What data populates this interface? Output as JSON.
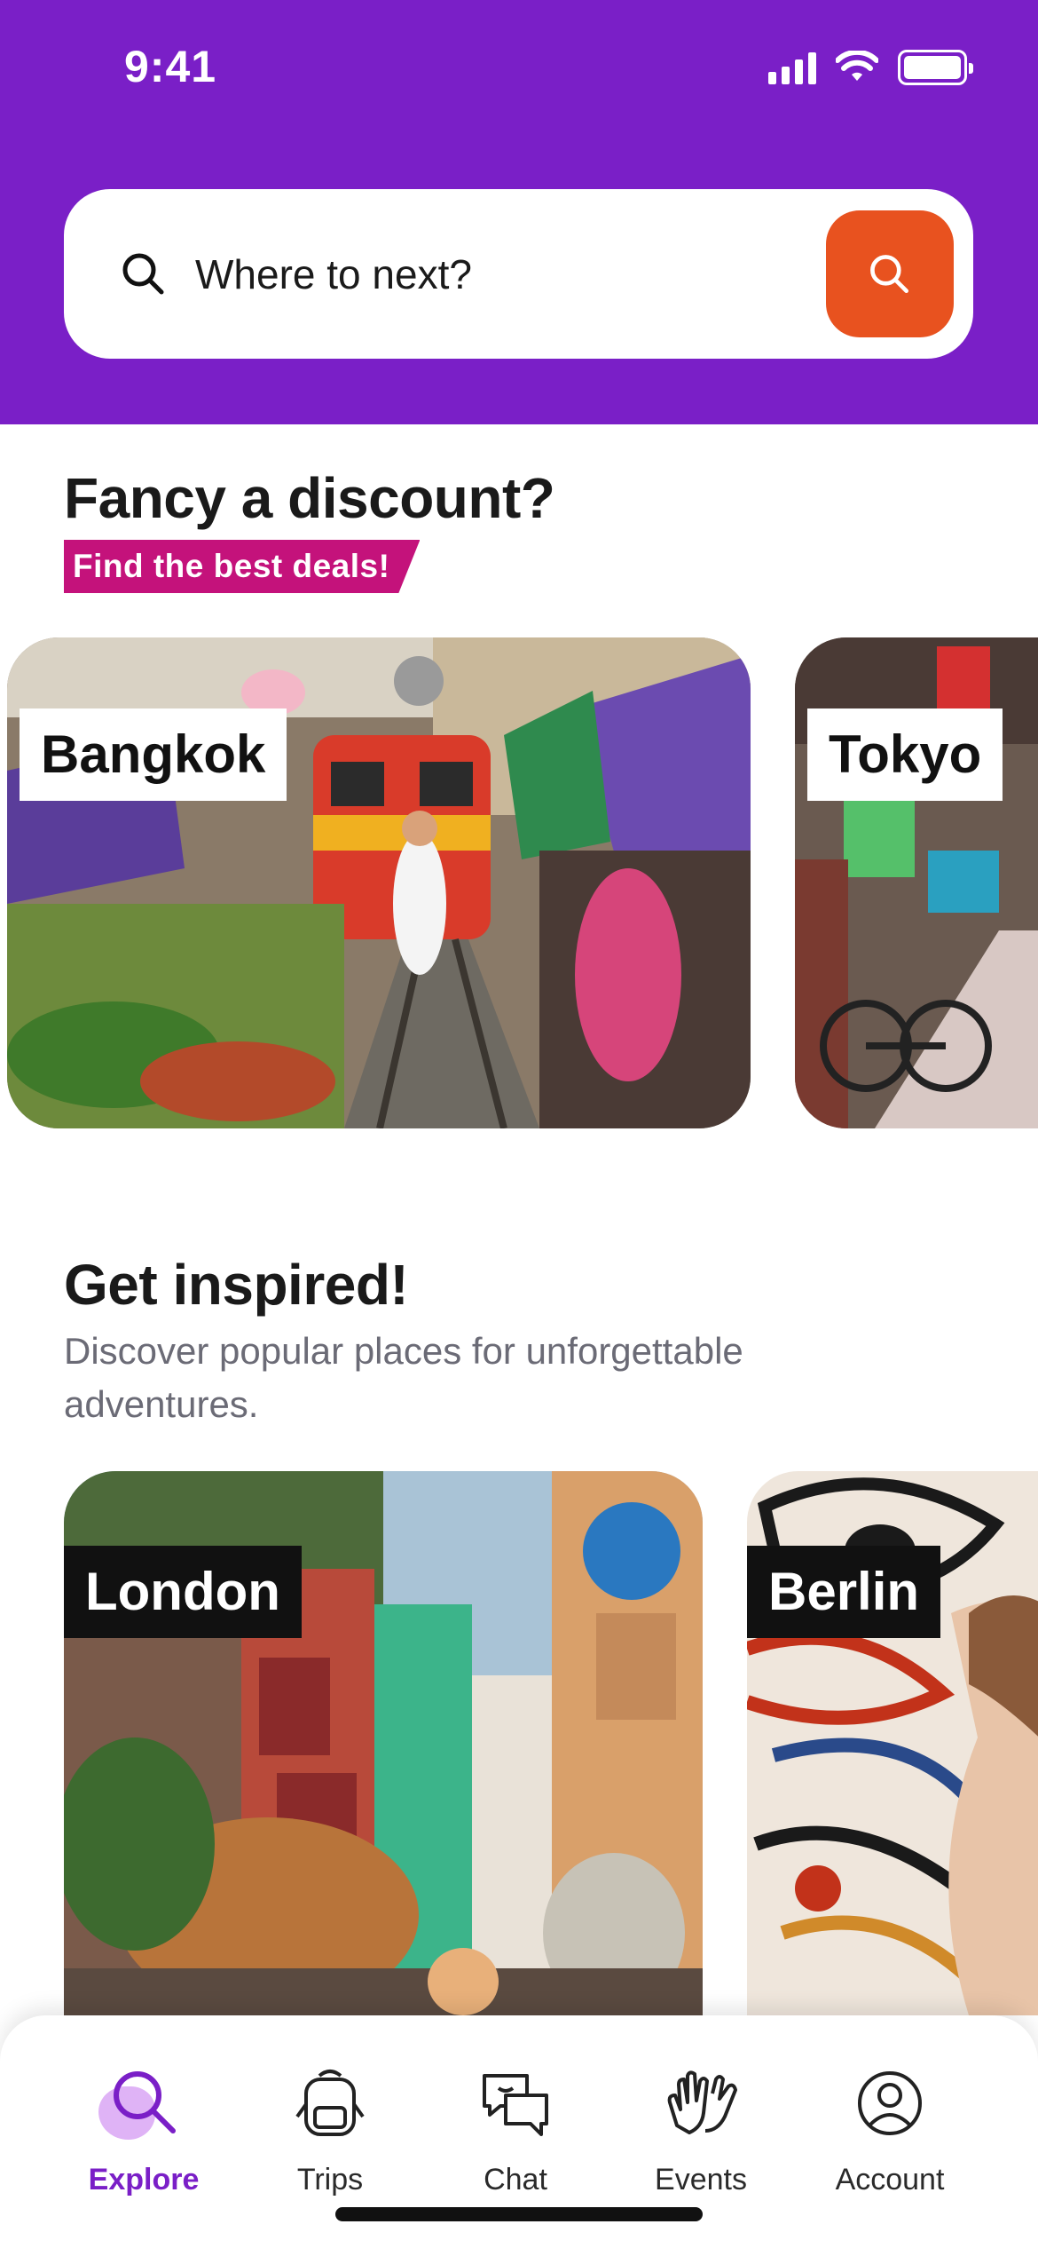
{
  "status_bar": {
    "time": "9:41"
  },
  "search": {
    "placeholder": "Where to next?",
    "search_icon": "search-icon",
    "button_icon": "search-icon"
  },
  "discount": {
    "title": "Fancy a discount?",
    "tag": "Find the best deals!",
    "cards": [
      {
        "city": "Bangkok"
      },
      {
        "city": "Tokyo"
      }
    ]
  },
  "inspired": {
    "title": "Get inspired!",
    "subtitle": "Discover popular places for unforgettable adventures.",
    "cards": [
      {
        "city": "London"
      },
      {
        "city": "Berlin"
      }
    ]
  },
  "nav": {
    "items": [
      {
        "label": "Explore",
        "icon": "search-icon",
        "active": true
      },
      {
        "label": "Trips",
        "icon": "backpack-icon",
        "active": false
      },
      {
        "label": "Chat",
        "icon": "chat-icon",
        "active": false
      },
      {
        "label": "Events",
        "icon": "hands-icon",
        "active": false
      },
      {
        "label": "Account",
        "icon": "account-icon",
        "active": false
      }
    ]
  },
  "colors": {
    "header": "#7a1fc7",
    "accent": "#e8521f",
    "tag": "#c4127b",
    "active_nav": "#7a1fc7"
  }
}
